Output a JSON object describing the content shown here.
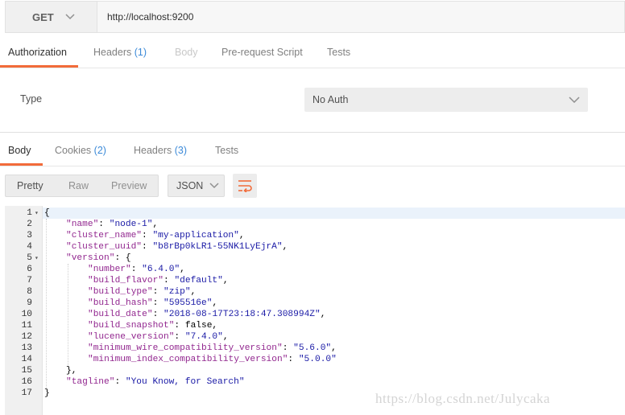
{
  "request": {
    "method": "GET",
    "url": "http://localhost:9200"
  },
  "request_tabs": [
    {
      "label": "Authorization",
      "count": "",
      "state": "active"
    },
    {
      "label": "Headers",
      "count": "(1)",
      "state": "normal"
    },
    {
      "label": "Body",
      "count": "",
      "state": "disabled"
    },
    {
      "label": "Pre-request Script",
      "count": "",
      "state": "normal"
    },
    {
      "label": "Tests",
      "count": "",
      "state": "normal"
    }
  ],
  "auth": {
    "type_label": "Type",
    "selected": "No Auth"
  },
  "response_tabs": [
    {
      "label": "Body",
      "count": "",
      "state": "active"
    },
    {
      "label": "Cookies",
      "count": "(2)",
      "state": "normal"
    },
    {
      "label": "Headers",
      "count": "(3)",
      "state": "normal"
    },
    {
      "label": "Tests",
      "count": "",
      "state": "normal"
    }
  ],
  "view": {
    "modes": [
      "Pretty",
      "Raw",
      "Preview"
    ],
    "active_mode": "Pretty",
    "format": "JSON",
    "wrap_icon": "wrap-lines-icon"
  },
  "code_lines": [
    {
      "n": "1",
      "fold": true,
      "indent": 0,
      "parts": [
        [
          "p",
          "{"
        ]
      ]
    },
    {
      "n": "2",
      "fold": false,
      "indent": 1,
      "parts": [
        [
          "k",
          "\"name\""
        ],
        [
          "p",
          ": "
        ],
        [
          "s",
          "\"node-1\""
        ],
        [
          "p",
          ","
        ]
      ]
    },
    {
      "n": "3",
      "fold": false,
      "indent": 1,
      "parts": [
        [
          "k",
          "\"cluster_name\""
        ],
        [
          "p",
          ": "
        ],
        [
          "s",
          "\"my-application\""
        ],
        [
          "p",
          ","
        ]
      ]
    },
    {
      "n": "4",
      "fold": false,
      "indent": 1,
      "parts": [
        [
          "k",
          "\"cluster_uuid\""
        ],
        [
          "p",
          ": "
        ],
        [
          "s",
          "\"b8rBp0kLR1-55NK1LyEjrA\""
        ],
        [
          "p",
          ","
        ]
      ]
    },
    {
      "n": "5",
      "fold": true,
      "indent": 1,
      "parts": [
        [
          "k",
          "\"version\""
        ],
        [
          "p",
          ": {"
        ]
      ]
    },
    {
      "n": "6",
      "fold": false,
      "indent": 2,
      "parts": [
        [
          "k",
          "\"number\""
        ],
        [
          "p",
          ": "
        ],
        [
          "s",
          "\"6.4.0\""
        ],
        [
          "p",
          ","
        ]
      ]
    },
    {
      "n": "7",
      "fold": false,
      "indent": 2,
      "parts": [
        [
          "k",
          "\"build_flavor\""
        ],
        [
          "p",
          ": "
        ],
        [
          "s",
          "\"default\""
        ],
        [
          "p",
          ","
        ]
      ]
    },
    {
      "n": "8",
      "fold": false,
      "indent": 2,
      "parts": [
        [
          "k",
          "\"build_type\""
        ],
        [
          "p",
          ": "
        ],
        [
          "s",
          "\"zip\""
        ],
        [
          "p",
          ","
        ]
      ]
    },
    {
      "n": "9",
      "fold": false,
      "indent": 2,
      "parts": [
        [
          "k",
          "\"build_hash\""
        ],
        [
          "p",
          ": "
        ],
        [
          "s",
          "\"595516e\""
        ],
        [
          "p",
          ","
        ]
      ]
    },
    {
      "n": "10",
      "fold": false,
      "indent": 2,
      "parts": [
        [
          "k",
          "\"build_date\""
        ],
        [
          "p",
          ": "
        ],
        [
          "s",
          "\"2018-08-17T23:18:47.308994Z\""
        ],
        [
          "p",
          ","
        ]
      ]
    },
    {
      "n": "11",
      "fold": false,
      "indent": 2,
      "parts": [
        [
          "k",
          "\"build_snapshot\""
        ],
        [
          "p",
          ": false,"
        ]
      ]
    },
    {
      "n": "12",
      "fold": false,
      "indent": 2,
      "parts": [
        [
          "k",
          "\"lucene_version\""
        ],
        [
          "p",
          ": "
        ],
        [
          "s",
          "\"7.4.0\""
        ],
        [
          "p",
          ","
        ]
      ]
    },
    {
      "n": "13",
      "fold": false,
      "indent": 2,
      "parts": [
        [
          "k",
          "\"minimum_wire_compatibility_version\""
        ],
        [
          "p",
          ": "
        ],
        [
          "s",
          "\"5.6.0\""
        ],
        [
          "p",
          ","
        ]
      ]
    },
    {
      "n": "14",
      "fold": false,
      "indent": 2,
      "parts": [
        [
          "k",
          "\"minimum_index_compatibility_version\""
        ],
        [
          "p",
          ": "
        ],
        [
          "s",
          "\"5.0.0\""
        ]
      ]
    },
    {
      "n": "15",
      "fold": false,
      "indent": 1,
      "parts": [
        [
          "p",
          "},"
        ]
      ]
    },
    {
      "n": "16",
      "fold": false,
      "indent": 1,
      "parts": [
        [
          "k",
          "\"tagline\""
        ],
        [
          "p",
          ": "
        ],
        [
          "s",
          "\"You Know, for Search\""
        ]
      ]
    },
    {
      "n": "17",
      "fold": false,
      "indent": 0,
      "parts": [
        [
          "p",
          "}"
        ]
      ]
    }
  ],
  "watermark": "https://blog.csdn.net/Julycaka",
  "colors": {
    "accent": "#f26b3a",
    "count": "#3c8ad8",
    "json_key": "#92278f",
    "json_string": "#1a1aa6"
  }
}
